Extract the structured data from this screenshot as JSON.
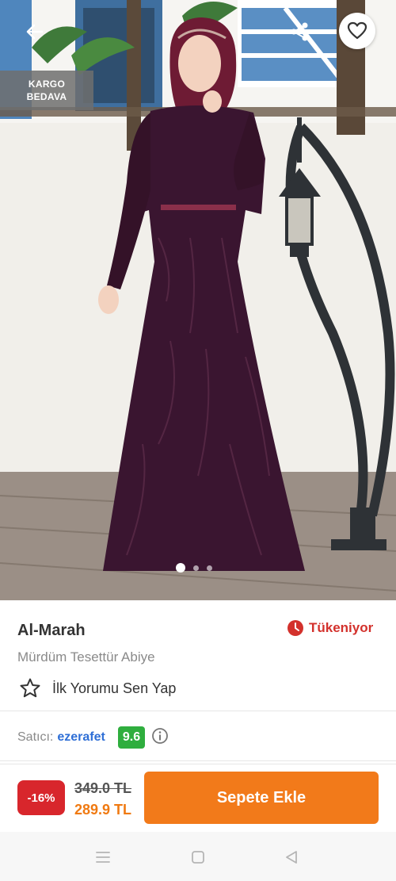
{
  "header": {
    "back_icon": "arrow-left-icon",
    "share_icon": "share-icon",
    "favorite_icon": "heart-outline-icon",
    "badge_line1": "KARGO",
    "badge_line2": "BEDAVA"
  },
  "gallery": {
    "image_count": 3,
    "active_index": 0
  },
  "product": {
    "brand": "Al-Marah",
    "name": "Mürdüm Tesettür Abiye",
    "stock_status": "Tükeniyor",
    "stock_icon": "clock-icon",
    "review_prompt": "İlk Yorumu Sen Yap",
    "review_icon": "star-outline-icon"
  },
  "seller": {
    "label": "Satıcı:",
    "name": "ezerafet",
    "score": "9.6",
    "info_icon": "info-icon"
  },
  "pricing": {
    "discount": "-16%",
    "old_price": "349.0 TL",
    "new_price": "289.9 TL",
    "add_to_cart": "Sepete Ekle"
  },
  "system_nav": {
    "menu_icon": "menu-icon",
    "home_icon": "square-home-icon",
    "back_icon": "triangle-back-icon"
  },
  "colors": {
    "accent": "#f27a1a",
    "discount_bg": "#d8262c",
    "stock_red": "#d3312c",
    "score_green": "#2fae3e",
    "seller_blue": "#2f6fd6",
    "dress": "#3a1530"
  }
}
